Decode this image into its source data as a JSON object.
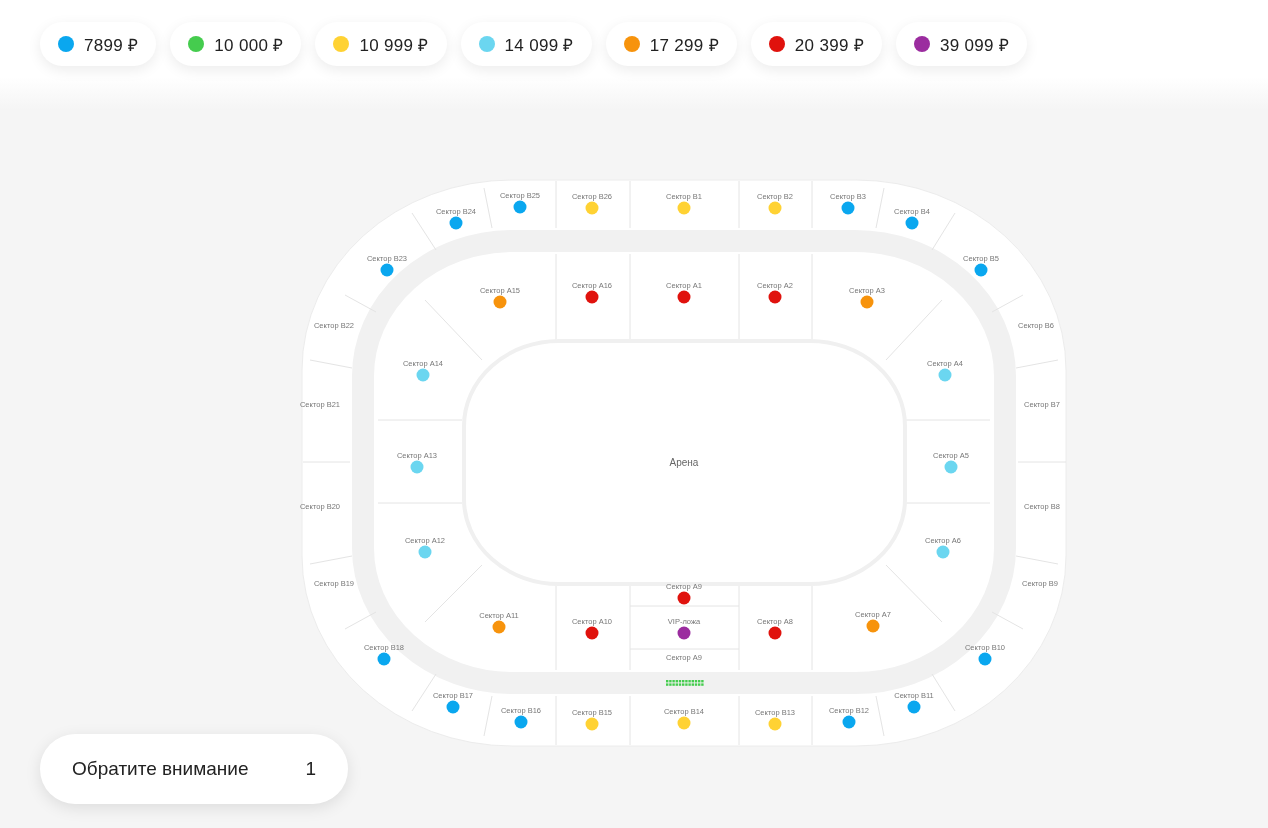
{
  "prices": [
    {
      "label": "7899 ₽",
      "color": "#0aa7ef"
    },
    {
      "label": "10 000 ₽",
      "color": "#45cc4e"
    },
    {
      "label": "10 999 ₽",
      "color": "#ffd233"
    },
    {
      "label": "14 099 ₽",
      "color": "#6bd6f0"
    },
    {
      "label": "17 299 ₽",
      "color": "#f7930c"
    },
    {
      "label": "20 399 ₽",
      "color": "#e0120d"
    },
    {
      "label": "39 099 ₽",
      "color": "#9b2c9f"
    }
  ],
  "map": {
    "arena_label": "Арена",
    "sectors": [
      {
        "label": "Сектор B23",
        "color": "#0aa7ef"
      },
      {
        "label": "Сектор B24",
        "color": "#0aa7ef"
      },
      {
        "label": "Сектор B25",
        "color": "#0aa7ef"
      },
      {
        "label": "Сектор B26",
        "color": "#ffd233"
      },
      {
        "label": "Сектор B1",
        "color": "#ffd233"
      },
      {
        "label": "Сектор B2",
        "color": "#ffd233"
      },
      {
        "label": "Сектор B3",
        "color": "#0aa7ef"
      },
      {
        "label": "Сектор B4",
        "color": "#0aa7ef"
      },
      {
        "label": "Сектор B5",
        "color": "#0aa7ef"
      },
      {
        "label": "Сектор A15",
        "color": "#f7930c"
      },
      {
        "label": "Сектор A16",
        "color": "#e0120d"
      },
      {
        "label": "Сектор A1",
        "color": "#e0120d"
      },
      {
        "label": "Сектор A2",
        "color": "#e0120d"
      },
      {
        "label": "Сектор A3",
        "color": "#f7930c"
      },
      {
        "label": "Сектор A14",
        "color": "#6bd6f0"
      },
      {
        "label": "Сектор A4",
        "color": "#6bd6f0"
      },
      {
        "label": "Сектор A13",
        "color": "#6bd6f0"
      },
      {
        "label": "Сектор A5",
        "color": "#6bd6f0"
      },
      {
        "label": "Сектор A12",
        "color": "#6bd6f0"
      },
      {
        "label": "Сектор A6",
        "color": "#6bd6f0"
      },
      {
        "label": "Сектор A9",
        "color": "#e0120d"
      },
      {
        "label": "VIP-ложа",
        "color": "#9b2c9f"
      },
      {
        "label": "Сектор A11",
        "color": "#f7930c"
      },
      {
        "label": "Сектор A10",
        "color": "#e0120d"
      },
      {
        "label": "Сектор A8",
        "color": "#e0120d"
      },
      {
        "label": "Сектор A7",
        "color": "#f7930c"
      },
      {
        "label": "Сектор B18",
        "color": "#0aa7ef"
      },
      {
        "label": "Сектор B10",
        "color": "#0aa7ef"
      },
      {
        "label": "Сектор B17",
        "color": "#0aa7ef"
      },
      {
        "label": "Сектор B11",
        "color": "#0aa7ef"
      },
      {
        "label": "Сектор B16",
        "color": "#0aa7ef"
      },
      {
        "label": "Сектор B15",
        "color": "#ffd233"
      },
      {
        "label": "Сектор B14",
        "color": "#ffd233"
      },
      {
        "label": "Сектор B13",
        "color": "#ffd233"
      },
      {
        "label": "Сектор B12",
        "color": "#0aa7ef"
      }
    ],
    "closed_sectors": [
      "Сектор B22",
      "Сектор B6",
      "Сектор B21",
      "Сектор B7",
      "Сектор B20",
      "Сектор B8",
      "Сектор B19",
      "Сектор B9",
      "Сектор A9"
    ]
  },
  "notice_button": {
    "label": "Обратите внимание",
    "count": "1"
  }
}
